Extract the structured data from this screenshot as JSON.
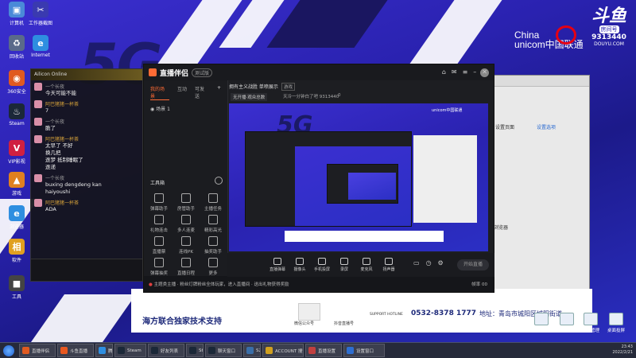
{
  "desktop": {
    "icons": [
      {
        "label": "计算机",
        "color": "#4a8ad8",
        "glyph": "▣"
      },
      {
        "label": "工作器截图",
        "color": "#3a3ab0",
        "glyph": "✂"
      },
      {
        "label": "回收站",
        "color": "#5a6a8a",
        "glyph": "♻"
      },
      {
        "label": "Internet",
        "color": "#2e8ee0",
        "glyph": "e"
      },
      {
        "label": "360安全",
        "color": "#e05a20",
        "glyph": "◉"
      },
      {
        "label": "Steam",
        "color": "#1b2838",
        "glyph": "♨"
      },
      {
        "label": "VIP影视",
        "color": "#d02040",
        "glyph": "V"
      },
      {
        "label": "游戏",
        "color": "#e08020",
        "glyph": "▲"
      },
      {
        "label": "浏览器",
        "color": "#2e8ee0",
        "glyph": "e"
      },
      {
        "label": "软件",
        "color": "#e0a020",
        "glyph": "相"
      },
      {
        "label": "工具",
        "color": "#444",
        "glyph": "■"
      }
    ],
    "right_icons": [
      {
        "label": "个人设置",
        "glyph": "◻"
      },
      {
        "label": "我的",
        "glyph": "▭"
      },
      {
        "label": "屏幕管理",
        "glyph": "▭"
      },
      {
        "label": "桌面投屏",
        "glyph": "▭"
      }
    ],
    "big_text": "5G"
  },
  "brand": {
    "unicom_line1": "China",
    "unicom_line2": "unicom中国联通",
    "douyu_logo": "斗鱼",
    "douyu_tag": "房间号",
    "room_number": "9313440",
    "douyu_sub": "DOUYU.COM"
  },
  "chat": {
    "header": "Ailicon Online",
    "messages": [
      {
        "name": "一个长夜",
        "gold": false,
        "text": "今天可能不能"
      },
      {
        "name": "阿巴猪猪一杯茶",
        "gold": true,
        "text": "7"
      },
      {
        "name": "一个长夜",
        "gold": false,
        "text": "脆了"
      },
      {
        "name": "阿巴猪猪一杯茶",
        "gold": true,
        "text": "太早了 不好\n换几把\n逐梦 抵制睡眠了\n逐递"
      },
      {
        "name": "一个长夜",
        "gold": false,
        "text": "buxing dengdeng kan\nhaiyoushi"
      },
      {
        "name": "阿巴猪猪一杯茶",
        "gold": true,
        "text": "ADA"
      }
    ]
  },
  "app": {
    "title": "直播伴侣",
    "version": "测试版",
    "tabs": [
      "我的场景",
      "互动",
      "可发送"
    ],
    "scene": "场景 1",
    "room_title": "拥有主义战胜 单喷展示",
    "room_tag": "游戏",
    "room_status": "无开播·观众总数",
    "room_info": "天冷一分钟白了吧 9313440",
    "room_like": "0",
    "toolbox": "工具箱",
    "tools": [
      "弹幕助手",
      "房管助手",
      "主播任务",
      "礼物连击",
      "多人连麦",
      "精彩高光",
      "直播票",
      "连线PK",
      "抽奖助手",
      "弹幕抽奖",
      "直播日程",
      "更多"
    ],
    "bottom_buttons": [
      "直播弹幕",
      "摄像头",
      "手机投屏",
      "录屏",
      "麦克风",
      "扬声器"
    ],
    "live_button": "开始直播",
    "status_text": "主题类主播 · 粉丝灯牌粉丝全体玩家，进入直播间 · 送出礼物获得奖励",
    "status_right": "帧率 00"
  },
  "right_window": {
    "label": "设置选项",
    "text1": "设置页面",
    "text2": "浏览器"
  },
  "banner": {
    "title": "海方联合独家技术支持",
    "phone": "0532-8378 1777",
    "address": "地址：青岛市城阳区城阳街道",
    "chips": [
      "微信公众号",
      "抖音直播号",
      "SUPPORT HOTLINE"
    ]
  },
  "taskbar": {
    "items": [
      {
        "label": "直播伴侣",
        "color": "#e05a20"
      },
      {
        "label": "斗鱼直播",
        "color": "#e85820"
      },
      {
        "label": "腾讯QQ",
        "color": "#2e8ee0"
      },
      {
        "label": "Steam",
        "color": "#1b2838"
      },
      {
        "label": "好友列表",
        "color": "#1b2838"
      },
      {
        "label": "Steam",
        "color": "#1b2838"
      },
      {
        "label": "聊天窗口",
        "color": "#1b2838"
      },
      {
        "label": "S2",
        "color": "#3a6ea8"
      },
      {
        "label": "ACCOUNT 搜索",
        "color": "#d0a020"
      },
      {
        "label": "直播设置",
        "color": "#c04040"
      },
      {
        "label": "设置窗口",
        "color": "#2e6ed0"
      }
    ],
    "time": "23:43",
    "date": "2022/2/21"
  }
}
